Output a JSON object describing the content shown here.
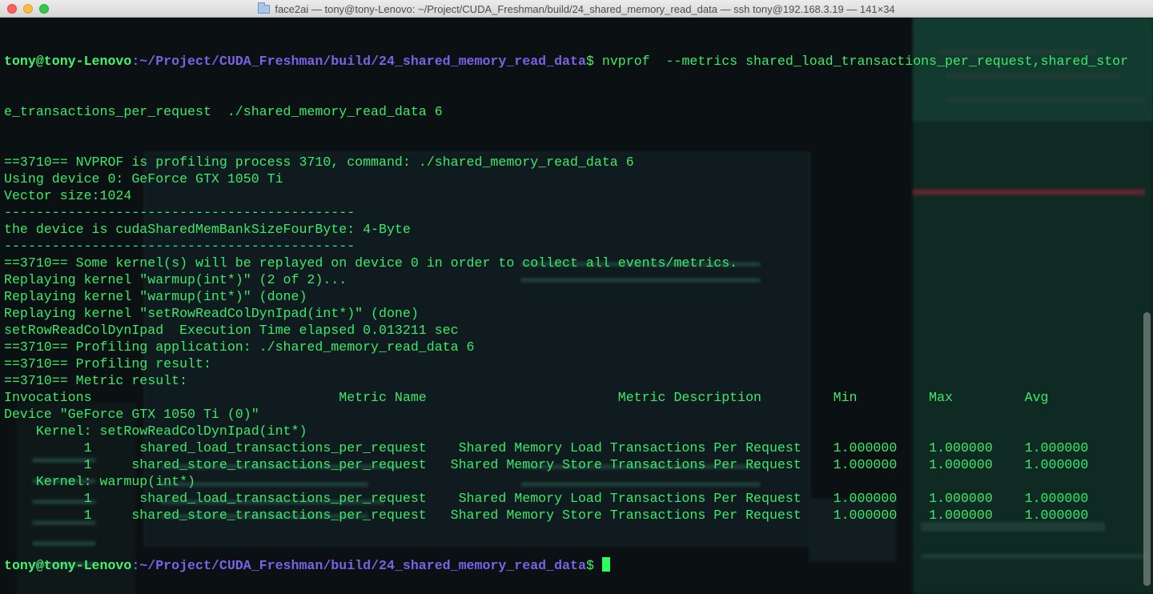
{
  "window": {
    "title": "face2ai — tony@tony-Lenovo: ~/Project/CUDA_Freshman/build/24_shared_memory_read_data — ssh tony@192.168.3.19 — 141×34"
  },
  "terminal": {
    "prompt": {
      "user_host": "tony@tony-Lenovo",
      "path": ":~/Project/CUDA_Freshman/build/24_shared_memory_read_data",
      "sign": "$ "
    },
    "command_part1": "nvprof  --metrics shared_load_transactions_per_request,shared_stor",
    "command_part2": "e_transactions_per_request  ./shared_memory_read_data 6",
    "output": [
      "==3710== NVPROF is profiling process 3710, command: ./shared_memory_read_data 6",
      "Using device 0: GeForce GTX 1050 Ti",
      "Vector size:1024",
      "--------------------------------------------",
      "the device is cudaSharedMemBankSizeFourByte: 4-Byte",
      "--------------------------------------------",
      "==3710== Some kernel(s) will be replayed on device 0 in order to collect all events/metrics.",
      "Replaying kernel \"warmup(int*)\" (2 of 2)...",
      "Replaying kernel \"warmup(int*)\" (done)",
      "Replaying kernel \"setRowReadColDynIpad(int*)\" (done)",
      "setRowReadColDynIpad  Execution Time elapsed 0.013211 sec",
      "==3710== Profiling application: ./shared_memory_read_data 6",
      "==3710== Profiling result:",
      "==3710== Metric result:",
      "Invocations                               Metric Name                        Metric Description         Min         Max         Avg",
      "Device \"GeForce GTX 1050 Ti (0)\"",
      "    Kernel: setRowReadColDynIpad(int*)",
      "          1      shared_load_transactions_per_request    Shared Memory Load Transactions Per Request    1.000000    1.000000    1.000000",
      "          1     shared_store_transactions_per_request   Shared Memory Store Transactions Per Request    1.000000    1.000000    1.000000",
      "    Kernel: warmup(int*)",
      "          1      shared_load_transactions_per_request    Shared Memory Load Transactions Per Request    1.000000    1.000000    1.000000",
      "          1     shared_store_transactions_per_request   Shared Memory Store Transactions Per Request    1.000000    1.000000    1.000000"
    ]
  },
  "colors": {
    "text": "#3ee86a",
    "prompt_user": "#47f06f",
    "prompt_path": "#7a62e6",
    "cursor": "#2cff5c"
  }
}
